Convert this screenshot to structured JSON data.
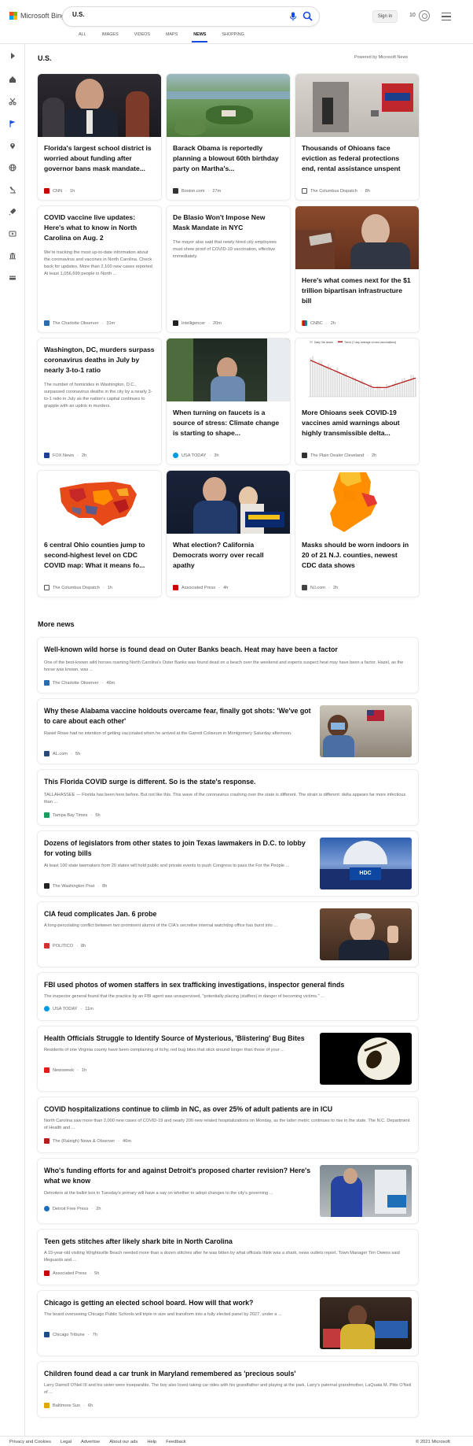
{
  "header": {
    "logo_text": "Microsoft Bing",
    "search_value": "U.S.",
    "signin": "Sign in",
    "points": "10",
    "tabs": [
      "ALL",
      "IMAGES",
      "VIDEOS",
      "MAPS",
      "NEWS",
      "SHOPPING"
    ],
    "active_tab": "NEWS"
  },
  "section": {
    "title": "U.S.",
    "powered_by": "Powered by Microsoft News"
  },
  "cards": [
    {
      "title": "Florida's largest school district is worried about funding after governor bans mask mandate...",
      "snippet": "",
      "source": "CNN",
      "time": "1h",
      "color": "#cc0000"
    },
    {
      "title": "Barack Obama is reportedly planning a blowout 60th birthday party on Martha's...",
      "snippet": "",
      "source": "Boston.com",
      "time": "27m",
      "color": "#333333"
    },
    {
      "title": "Thousands of Ohioans face eviction as federal protections end, rental assistance unspent",
      "snippet": "",
      "source": "The Columbus Dispatch",
      "time": "8h",
      "color": "#555555"
    },
    {
      "title": "COVID vaccine live updates: Here's what to know in North Carolina on Aug. 2",
      "snippet": "We're tracking the most up-to-date information about the coronavirus and vaccines in North Carolina. Check back for updates. More than 2,100 new cases reported At least 1,056,699 people in North ...",
      "source": "The Charlotte Observer",
      "time": "31m",
      "color": "#2b6cb0"
    },
    {
      "title": "De Blasio Won't Impose New Mask Mandate in NYC",
      "snippet": "The mayor also said that newly hired city employees must show proof of COVID-19 vaccination, effective immediately.",
      "source": "Intelligencer",
      "time": "20m",
      "color": "#222222"
    },
    {
      "title": "Here's what comes next for the $1 trillion bipartisan infrastructure bill",
      "snippet": "",
      "source": "CNBC",
      "time": "2h",
      "color": "#e57c24"
    },
    {
      "title": "Washington, DC, murders surpass coronavirus deaths in July by nearly 3-to-1 ratio",
      "snippet": "The number of homicides in Washington, D.C., surpassed coronavirus deaths in the city by a nearly 3-to-1 ratio in July as the nation's capital continues to grapple with an uptick in murders.",
      "source": "FOX News",
      "time": "2h",
      "color": "#1c3f94"
    },
    {
      "title": "When turning on faucets is a source of stress: Climate change is starting to shape...",
      "snippet": "",
      "source": "USA TODAY",
      "time": "3h",
      "color": "#009bde"
    },
    {
      "title": "More Ohioans seek COVID-19 vaccines amid warnings about highly transmissible delta...",
      "snippet": "",
      "source": "The Plain Dealer Cleveland",
      "time": "2h",
      "color": "#333333"
    },
    {
      "title": "6 central Ohio counties jump to second-highest level on CDC COVID map: What it means fo...",
      "snippet": "",
      "source": "The Columbus Dispatch",
      "time": "1h",
      "color": "#555555"
    },
    {
      "title": "What election? California Democrats worry over recall apathy",
      "snippet": "",
      "source": "Associated Press",
      "time": "4h",
      "color": "#cc0000"
    },
    {
      "title": "Masks should be worn indoors in 20 of 21 N.J. counties, newest CDC data shows",
      "snippet": "",
      "source": "NJ.com",
      "time": "2h",
      "color": "#444444"
    }
  ],
  "chart_legend": {
    "daily": "Daily 3rk doses",
    "avg": "Trend (7-day average of new vaccinations)"
  },
  "more_news": {
    "title": "More news",
    "items": [
      {
        "title": "Well-known wild horse is found dead on Outer Banks beach. Heat may have been a factor",
        "snippet": "One of the best-known wild horses roaming North Carolina's Outer Banks was found dead on a beach over the weekend and experts suspect heat may have been a factor. Hazel, as the horse was known, was ...",
        "source": "The Charlotte Observer",
        "time": "46m",
        "color": "#2b6cb0"
      },
      {
        "title": "Why these Alabama vaccine holdouts overcame fear, finally got shots: 'We've got to care about each other'",
        "snippet": "Rasiel Rowe had no intention of getting vaccinated when he arrived at the Garrett Coliseum in Montgomery Saturday afternoon.",
        "source": "AL.com",
        "time": "5h",
        "color": "#2a4a7b"
      },
      {
        "title": "This Florida COVID surge is different. So is the state's response.",
        "snippet": "TALLAHASSEE — Florida has been here before. But not like this. This wave of the coronavirus crashing over the state is different. The strain is different: delta appears far more infectious than ...",
        "source": "Tampa Bay Times",
        "time": "5h",
        "color": "#1a9e5f"
      },
      {
        "title": "Dozens of legislators from other states to join Texas lawmakers in D.C. to lobby for voting bills",
        "snippet": "At least 100 state lawmakers from 20 states will hold public and private events to push Congress to pass the For the People ...",
        "source": "The Washington Post",
        "time": "8h",
        "color": "#222222"
      },
      {
        "title": "CIA feud complicates Jan. 6 probe",
        "snippet": "A long-percolating conflict between two prominent alumni of the CIA's secretive internal watchdog office has burst into ...",
        "source": "POLITICO",
        "time": "8h",
        "color": "#d32f2f"
      },
      {
        "title": "FBI used photos of women staffers in sex trafficking investigations, inspector general finds",
        "snippet": "The inspector general found that the practice by an FBI agent was unsupervised, \"potentially placing (staffers) in danger of becoming victims.\" ...",
        "source": "USA TODAY",
        "time": "11m",
        "color": "#009bde"
      },
      {
        "title": "Health Officials Struggle to Identify Source of Mysterious, 'Blistering' Bug Bites",
        "snippet": "Residents of one Virginia county have been complaining of itchy, red bug bites that stick around longer than those of your ...",
        "source": "Newsweek",
        "time": "1h",
        "color": "#e21b1b"
      },
      {
        "title": "COVID hospitalizations continue to climb in NC, as over 25% of adult patients are in ICU",
        "snippet": "North Carolina saw more than 2,000 new cases of COVID-19 and nearly 200 new related hospitalizations on Monday, as the latter metric continues to rise in the state. The N.C. Department of Health and ...",
        "source": "The (Raleigh) News & Observer",
        "time": "46m",
        "color": "#b91c1c"
      },
      {
        "title": "Who's funding efforts for and against Detroit's proposed charter revision? Here's what we know",
        "snippet": "Detroiters at the ballot box in Tuesday's primary will have a say on whether to adopt changes to the city's governing ...",
        "source": "Detroit Free Press",
        "time": "2h",
        "color": "#1e6fb8"
      },
      {
        "title": "Teen gets stitches after likely shark bite in North Carolina",
        "snippet": "A 15-year-old visiting Wrightsville Beach needed more than a dozen stitches after he was bitten by what officials think was a shark, news outlets report. Town Manager Tim Owens said lifeguards and ...",
        "source": "Associated Press",
        "time": "5h",
        "color": "#cc0000"
      },
      {
        "title": "Chicago is getting an elected school board. How will that work?",
        "snippet": "The board overseeing Chicago Public Schools will triple in size and transform into a fully elected panel by 2027, under a ...",
        "source": "Chicago Tribune",
        "time": "7h",
        "color": "#1d4e89"
      },
      {
        "title": "Children found dead a car trunk in Maryland remembered as 'precious souls'",
        "snippet": "Larry Darnell O'Neil III and his sister were inseparable. The boy also loved taking car rides with his grandfather and playing at the park, Larry's paternal grandmother, LaQuata M. Pitts O'Neil of ...",
        "source": "Baltimore Sun",
        "time": "6h",
        "color": "#e0a800"
      }
    ]
  },
  "footer": {
    "links": [
      "Privacy and Cookies",
      "Legal",
      "Advertise",
      "About our ads",
      "Help",
      "Feedback"
    ],
    "copyright": "© 2021 Microsoft"
  }
}
